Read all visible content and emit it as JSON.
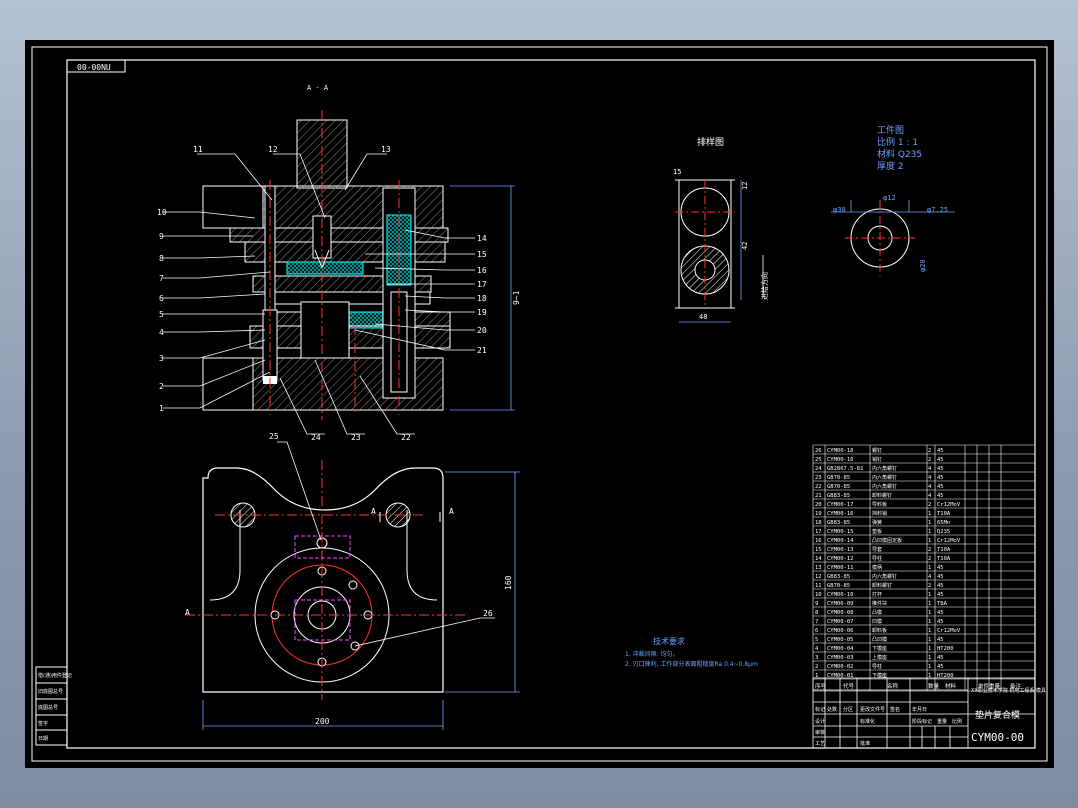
{
  "drawing": {
    "code_box": "00-00NU",
    "section_marker": "A - A",
    "callouts_front": [
      "1",
      "2",
      "3",
      "4",
      "5",
      "6",
      "7",
      "8",
      "9",
      "10",
      "11",
      "12",
      "13",
      "14",
      "15",
      "16",
      "17",
      "18",
      "19",
      "20",
      "21",
      "22",
      "23",
      "24"
    ],
    "callouts_plan": [
      "25",
      "26"
    ],
    "dim_height": "9~1",
    "dim_plan_width": "200",
    "dim_plan_height": "160",
    "plan_section_letter": "A",
    "layout_title": "排样图",
    "layout_dims": {
      "top": "15",
      "right_top": "12",
      "right_mid": "42",
      "bottom": "48",
      "side": "进给方向"
    },
    "workpiece": {
      "title": "工件图",
      "lines": [
        "比例 1 : 1",
        "材料 Q235",
        "厚度 2"
      ],
      "dims": [
        "φ30",
        "φ12",
        "φ7.25",
        "φ20"
      ]
    },
    "tech_notes": {
      "title": "技术要求",
      "lines": [
        "1. 冲裁间隙: 均匀。",
        "2. 刃口锋利, 工作部分表面粗糙度Ra 0.4~0.8μm"
      ]
    }
  },
  "bom": {
    "rows": [
      [
        "26",
        "CYM00-18",
        "螺钉",
        "2",
        "45"
      ],
      [
        "25",
        "CYM00-16",
        "销钉",
        "2",
        "45"
      ],
      [
        "24",
        "GB2867.5-81",
        "内六角螺钉",
        "4",
        "45"
      ],
      [
        "23",
        "GB70-85",
        "内六角螺钉",
        "4",
        "45"
      ],
      [
        "22",
        "GB70-85",
        "内六角螺钉",
        "4",
        "45"
      ],
      [
        "21",
        "GB83-85",
        "卸料螺钉",
        "4",
        "45"
      ],
      [
        "20",
        "CYM00-17",
        "导料板",
        "2",
        "Cr12MoV"
      ],
      [
        "19",
        "CYM00-16",
        "挡料销",
        "1",
        "T10A"
      ],
      [
        "18",
        "GB83-85",
        "弹簧",
        "1",
        "65Mn"
      ],
      [
        "17",
        "CYM00-15",
        "垫板",
        "1",
        "Q235"
      ],
      [
        "16",
        "CYM00-14",
        "凸凹模固定板",
        "1",
        "Cr12MoV"
      ],
      [
        "15",
        "CYM00-13",
        "导套",
        "2",
        "T10A"
      ],
      [
        "14",
        "CYM00-12",
        "导柱",
        "2",
        "T10A"
      ],
      [
        "13",
        "CYM00-11",
        "模柄",
        "1",
        "45"
      ],
      [
        "12",
        "GB83-85",
        "内六角螺钉",
        "4",
        "45"
      ],
      [
        "11",
        "GB70-85",
        "卸料螺钉",
        "2",
        "45"
      ],
      [
        "10",
        "CYM00-10",
        "打杆",
        "1",
        "45"
      ],
      [
        "9",
        "CYM00-09",
        "推件块",
        "1",
        "T8A"
      ],
      [
        "8",
        "CYM00-08",
        "凸模",
        "1",
        "45"
      ],
      [
        "7",
        "CYM00-07",
        "凹模",
        "1",
        "45"
      ],
      [
        "6",
        "CYM00-06",
        "卸料板",
        "1",
        "Cr12MoV"
      ],
      [
        "5",
        "CYM00-05",
        "凸凹模",
        "1",
        "45"
      ],
      [
        "4",
        "CYM00-04",
        "下模座",
        "1",
        "HT200"
      ],
      [
        "3",
        "CYM00-03",
        "上模座",
        "1",
        "45"
      ],
      [
        "2",
        "CYM00-02",
        "导柱",
        "1",
        "45"
      ],
      [
        "1",
        "CYM00-01",
        "下模座",
        "1",
        "HT200"
      ]
    ],
    "header": [
      "序号",
      "代号",
      "名称",
      "数量",
      "材料",
      "单件重量",
      "备注"
    ]
  },
  "title_block": {
    "name": "垫片复合模",
    "code": "CYM00-00",
    "school": "XX职业技术学院 机电工程系 模具",
    "labels": [
      "标记",
      "处数",
      "分区",
      "更改文件号",
      "签名",
      "年月日",
      "设计",
      "标准化",
      "审核",
      "工艺",
      "批准",
      "阶段标记",
      "重量",
      "比例"
    ]
  },
  "left_strip": [
    "借(通)用件登记",
    "旧底图总号",
    "底图总号",
    "签字",
    "日期"
  ]
}
